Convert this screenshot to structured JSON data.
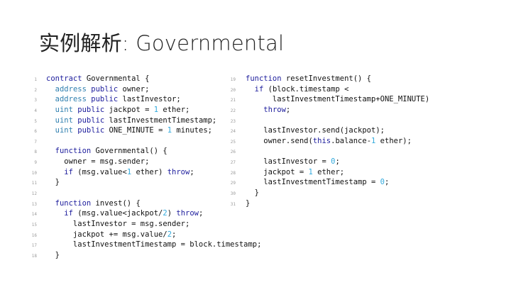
{
  "slide": {
    "title": "实例解析: Governmental"
  },
  "code": {
    "left": [
      {
        "num": "1",
        "tokens": [
          {
            "k": "k",
            "t": "contract"
          },
          {
            "k": "p",
            "t": " Governmental {"
          }
        ]
      },
      {
        "num": "2",
        "tokens": [
          {
            "k": "p",
            "t": "  "
          },
          {
            "k": "t",
            "t": "address"
          },
          {
            "k": "p",
            "t": " "
          },
          {
            "k": "k",
            "t": "public"
          },
          {
            "k": "p",
            "t": " owner;"
          }
        ]
      },
      {
        "num": "3",
        "tokens": [
          {
            "k": "p",
            "t": "  "
          },
          {
            "k": "t",
            "t": "address"
          },
          {
            "k": "p",
            "t": " "
          },
          {
            "k": "k",
            "t": "public"
          },
          {
            "k": "p",
            "t": " lastInvestor;"
          }
        ]
      },
      {
        "num": "4",
        "tokens": [
          {
            "k": "p",
            "t": "  "
          },
          {
            "k": "t",
            "t": "uint"
          },
          {
            "k": "p",
            "t": " "
          },
          {
            "k": "k",
            "t": "public"
          },
          {
            "k": "p",
            "t": " jackpot = "
          },
          {
            "k": "n",
            "t": "1"
          },
          {
            "k": "p",
            "t": " ether;"
          }
        ]
      },
      {
        "num": "5",
        "tokens": [
          {
            "k": "p",
            "t": "  "
          },
          {
            "k": "t",
            "t": "uint"
          },
          {
            "k": "p",
            "t": " "
          },
          {
            "k": "k",
            "t": "public"
          },
          {
            "k": "p",
            "t": " lastInvestmentTimestamp;"
          }
        ]
      },
      {
        "num": "6",
        "tokens": [
          {
            "k": "p",
            "t": "  "
          },
          {
            "k": "t",
            "t": "uint"
          },
          {
            "k": "p",
            "t": " "
          },
          {
            "k": "k",
            "t": "public"
          },
          {
            "k": "p",
            "t": " ONE_MINUTE = "
          },
          {
            "k": "n",
            "t": "1"
          },
          {
            "k": "p",
            "t": " minutes;"
          }
        ]
      },
      {
        "num": "7",
        "tokens": []
      },
      {
        "num": "8",
        "tokens": [
          {
            "k": "p",
            "t": "  "
          },
          {
            "k": "k",
            "t": "function"
          },
          {
            "k": "p",
            "t": " Governmental() {"
          }
        ]
      },
      {
        "num": "9",
        "tokens": [
          {
            "k": "p",
            "t": "    owner = msg.sender;"
          }
        ]
      },
      {
        "num": "10",
        "tokens": [
          {
            "k": "p",
            "t": "    "
          },
          {
            "k": "k",
            "t": "if"
          },
          {
            "k": "p",
            "t": " (msg.value<"
          },
          {
            "k": "n",
            "t": "1"
          },
          {
            "k": "p",
            "t": " ether) "
          },
          {
            "k": "k",
            "t": "throw"
          },
          {
            "k": "p",
            "t": ";"
          }
        ]
      },
      {
        "num": "11",
        "tokens": [
          {
            "k": "p",
            "t": "  }"
          }
        ]
      },
      {
        "num": "12",
        "tokens": []
      },
      {
        "num": "13",
        "tokens": [
          {
            "k": "p",
            "t": "  "
          },
          {
            "k": "k",
            "t": "function"
          },
          {
            "k": "p",
            "t": " invest() {"
          }
        ]
      },
      {
        "num": "14",
        "tokens": [
          {
            "k": "p",
            "t": "    "
          },
          {
            "k": "k",
            "t": "if"
          },
          {
            "k": "p",
            "t": " (msg.value<jackpot/"
          },
          {
            "k": "n",
            "t": "2"
          },
          {
            "k": "p",
            "t": ") "
          },
          {
            "k": "k",
            "t": "throw"
          },
          {
            "k": "p",
            "t": ";"
          }
        ]
      },
      {
        "num": "15",
        "tokens": [
          {
            "k": "p",
            "t": "      lastInvestor = msg.sender;"
          }
        ]
      },
      {
        "num": "16",
        "tokens": [
          {
            "k": "p",
            "t": "      jackpot += msg.value/"
          },
          {
            "k": "n",
            "t": "2"
          },
          {
            "k": "p",
            "t": ";"
          }
        ]
      },
      {
        "num": "17",
        "tokens": [
          {
            "k": "p",
            "t": "      lastInvestmentTimestamp = block.timestamp;"
          }
        ]
      },
      {
        "num": "18",
        "tokens": [
          {
            "k": "p",
            "t": "  }"
          }
        ]
      }
    ],
    "right": [
      {
        "num": "19",
        "tokens": [
          {
            "k": "k",
            "t": "function"
          },
          {
            "k": "p",
            "t": " resetInvestment() {"
          }
        ]
      },
      {
        "num": "20",
        "tokens": [
          {
            "k": "p",
            "t": "  "
          },
          {
            "k": "k",
            "t": "if"
          },
          {
            "k": "p",
            "t": " (block.timestamp <"
          }
        ]
      },
      {
        "num": "21",
        "tokens": [
          {
            "k": "p",
            "t": "      lastInvestmentTimestamp+ONE_MINUTE)"
          }
        ]
      },
      {
        "num": "22",
        "tokens": [
          {
            "k": "p",
            "t": "    "
          },
          {
            "k": "k",
            "t": "throw"
          },
          {
            "k": "p",
            "t": ";"
          }
        ]
      },
      {
        "num": "23",
        "tokens": []
      },
      {
        "num": "24",
        "tokens": [
          {
            "k": "p",
            "t": "    lastInvestor.send(jackpot);"
          }
        ]
      },
      {
        "num": "25",
        "tokens": [
          {
            "k": "p",
            "t": "    owner.send("
          },
          {
            "k": "k",
            "t": "this"
          },
          {
            "k": "p",
            "t": ".balance-"
          },
          {
            "k": "n",
            "t": "1"
          },
          {
            "k": "p",
            "t": " ether);"
          }
        ]
      },
      {
        "num": "26",
        "tokens": []
      },
      {
        "num": "27",
        "tokens": [
          {
            "k": "p",
            "t": "    lastInvestor = "
          },
          {
            "k": "n",
            "t": "0"
          },
          {
            "k": "p",
            "t": ";"
          }
        ]
      },
      {
        "num": "28",
        "tokens": [
          {
            "k": "p",
            "t": "    jackpot = "
          },
          {
            "k": "n",
            "t": "1"
          },
          {
            "k": "p",
            "t": " ether;"
          }
        ]
      },
      {
        "num": "29",
        "tokens": [
          {
            "k": "p",
            "t": "    lastInvestmentTimestamp = "
          },
          {
            "k": "n",
            "t": "0"
          },
          {
            "k": "p",
            "t": ";"
          }
        ]
      },
      {
        "num": "30",
        "tokens": [
          {
            "k": "p",
            "t": "  }"
          }
        ]
      },
      {
        "num": "31",
        "tokens": [
          {
            "k": "p",
            "t": "}"
          }
        ]
      }
    ]
  },
  "colors": {
    "keyword": "#1c1c9c",
    "type": "#2f7faf",
    "number": "#33aadd",
    "plain": "#111111",
    "line_number": "#9a9a9a"
  }
}
